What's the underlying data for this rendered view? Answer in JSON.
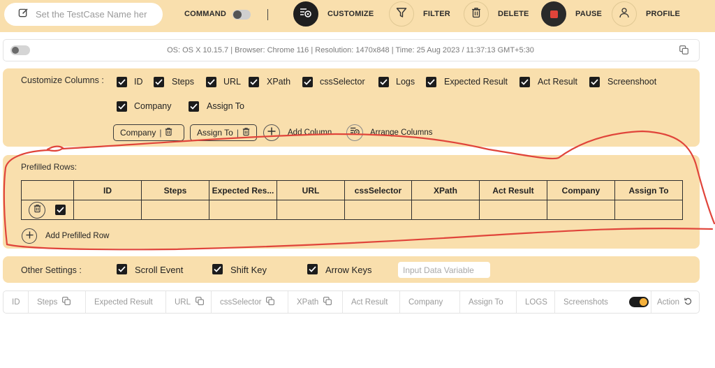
{
  "topbar": {
    "name_input_placeholder": "Set the TestCase Name here",
    "command_label": "COMMAND",
    "customize_label": "CUSTOMIZE",
    "filter_label": "FILTER",
    "delete_label": "DELETE",
    "pause_label": "PAUSE",
    "profile_label": "PROFILE",
    "icons": [
      "edit-icon",
      "customize-icon",
      "filter-icon",
      "trash-icon",
      "stop-icon",
      "user-icon"
    ]
  },
  "infobar": {
    "text": "OS: OS X 10.15.7 | Browser: Chrome 116 | Resolution: 1470x848 | Time: 25 Aug 2023 / 11:37:13 GMT+5:30"
  },
  "customize": {
    "label": "Customize Columns :",
    "columns": [
      {
        "label": "ID",
        "checked": true
      },
      {
        "label": "Steps",
        "checked": true
      },
      {
        "label": "URL",
        "checked": true
      },
      {
        "label": "XPath",
        "checked": true
      },
      {
        "label": "cssSelector",
        "checked": true
      },
      {
        "label": "Logs",
        "checked": true
      },
      {
        "label": "Expected Result",
        "checked": true
      },
      {
        "label": "Act Result",
        "checked": true
      },
      {
        "label": "Screenshoot",
        "checked": true
      },
      {
        "label": "Company",
        "checked": true
      },
      {
        "label": "Assign To",
        "checked": true
      }
    ],
    "chips": [
      "Company",
      "Assign To"
    ],
    "add_column_label": "Add Column",
    "arrange_columns_label": "Arrange Columns"
  },
  "prefilled": {
    "label": "Prefilled Rows:",
    "headers": [
      "",
      "ID",
      "Steps",
      "Expected Res...",
      "URL",
      "cssSelector",
      "XPath",
      "Act Result",
      "Company",
      "Assign To"
    ],
    "row_checked": true,
    "add_row_label": "Add Prefilled Row"
  },
  "other": {
    "label": "Other Settings :",
    "options": [
      {
        "label": "Scroll Event",
        "checked": true
      },
      {
        "label": "Shift Key",
        "checked": true
      },
      {
        "label": "Arrow Keys",
        "checked": true
      }
    ],
    "input_placeholder": "Input Data Variable"
  },
  "columns_bar": {
    "cells": [
      "ID",
      "Steps",
      "Expected Result",
      "URL",
      "cssSelector",
      "XPath",
      "Act Result",
      "Company",
      "Assign To",
      "LOGS",
      "Screenshots",
      "Action"
    ],
    "screenshots_toggle_on": true
  },
  "colors": {
    "panel_bg": "#f9dfad",
    "annotation_red": "#e0443a",
    "toggle_knob": "#f5b13b"
  }
}
